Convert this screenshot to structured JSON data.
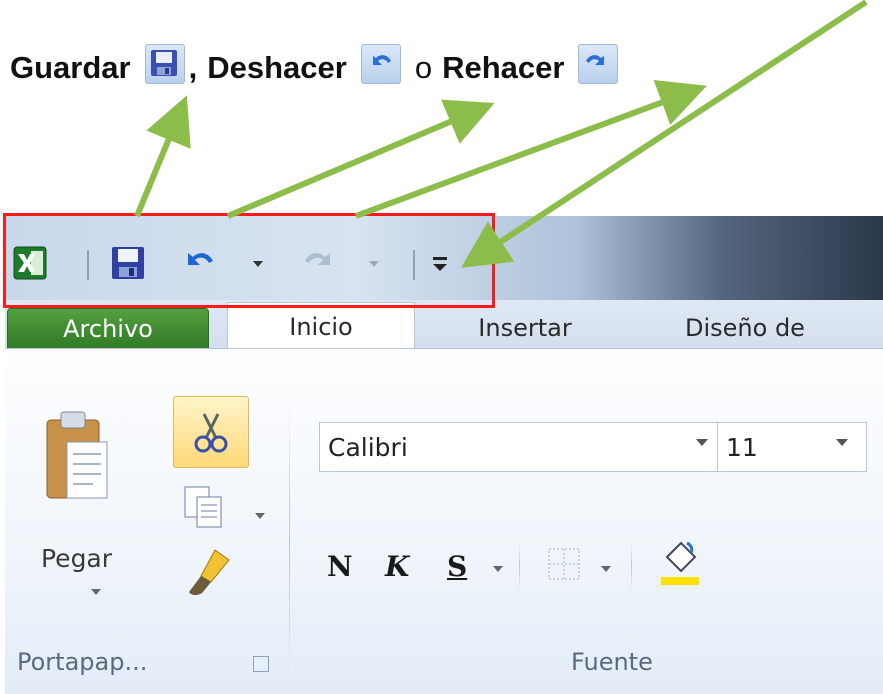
{
  "caption": {
    "guardar": "Guardar",
    "comma": ",",
    "deshacer": "Deshacer",
    "o": "o",
    "rehacer": "Rehacer"
  },
  "quick_access_toolbar": {
    "items": [
      "excel-logo-icon",
      "save-icon",
      "undo-icon",
      "undo-dropdown-icon",
      "redo-icon",
      "redo-dropdown-icon",
      "customize-qat-icon"
    ],
    "highlight_color": "#ff1a1a",
    "arrow_color": "#8cbd4b"
  },
  "ribbon": {
    "tabs": [
      {
        "label": "Archivo",
        "color": "#3c8a2e"
      },
      {
        "label": "Inicio"
      },
      {
        "label": "Insertar"
      },
      {
        "label": "Diseño de"
      }
    ],
    "clipboard": {
      "paste_label": "Pegar",
      "group_label": "Portapap...",
      "icons": [
        "paste-icon",
        "cut-icon",
        "copy-icon",
        "format-painter-icon",
        "dialog-launcher-icon"
      ]
    },
    "font": {
      "font_name": "Calibri",
      "font_size": "11",
      "bold": "N",
      "italic": "K",
      "underline": "S",
      "group_label": "Fuente",
      "icons": [
        "borders-icon",
        "fill-color-icon"
      ]
    }
  }
}
